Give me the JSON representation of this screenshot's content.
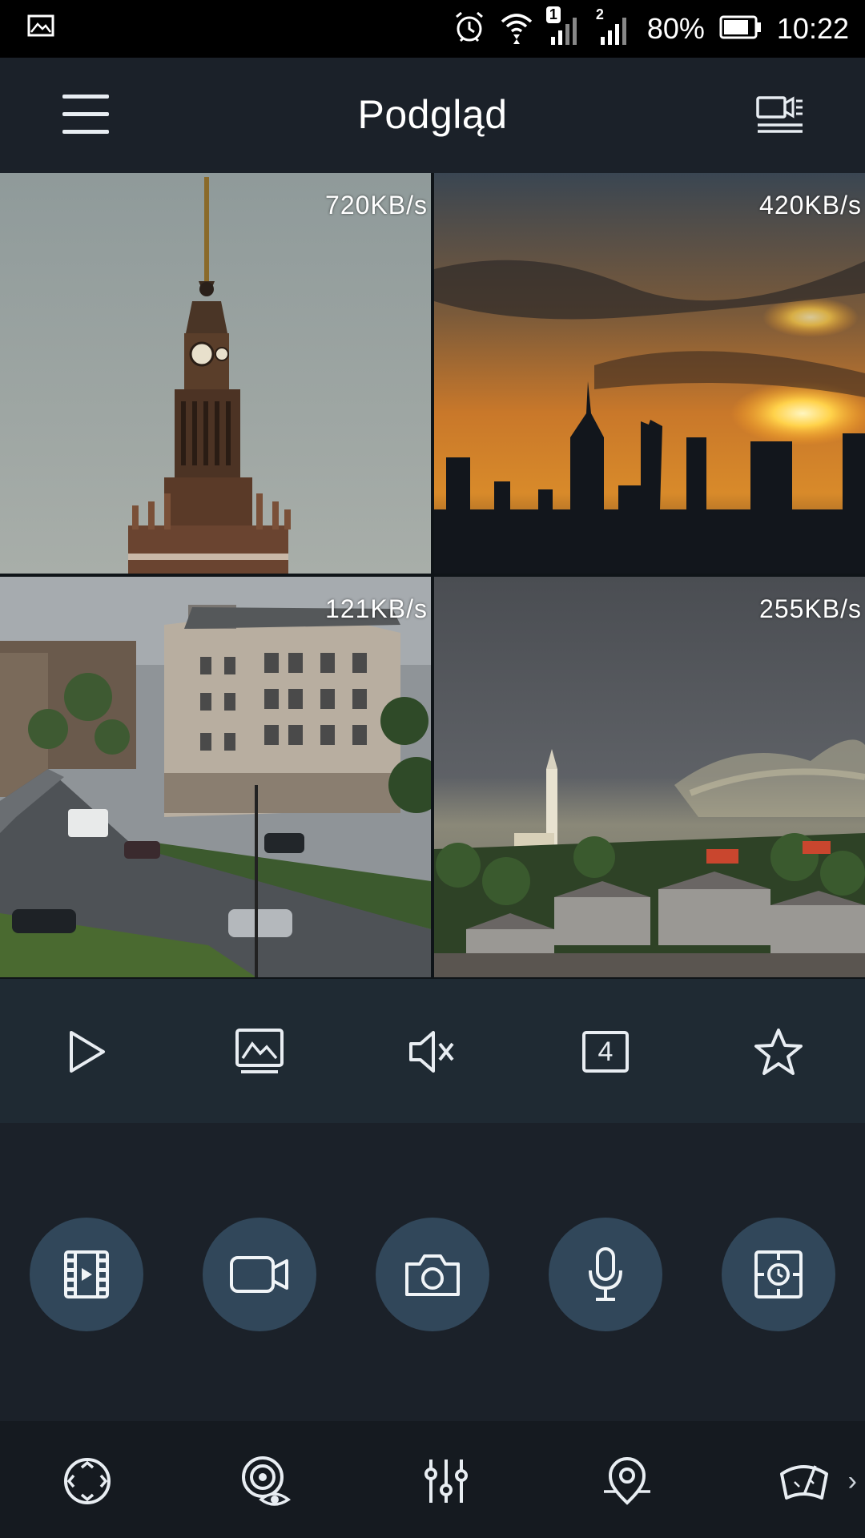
{
  "status_bar": {
    "battery_text": "80%",
    "time": "10:22",
    "sim1_label": "1",
    "sim2_label": "2",
    "icons": [
      "gallery-icon",
      "alarm-icon",
      "wifi-icon",
      "signal-sim1-icon",
      "signal-sim2-icon",
      "battery-icon"
    ]
  },
  "header": {
    "title": "Podgląd",
    "menu_icon": "hamburger-menu-icon",
    "right_icon": "camera-list-icon"
  },
  "tiles": [
    {
      "rate": "720KB/s",
      "scene": "palace-of-culture-tower",
      "selected": true
    },
    {
      "rate": "420KB/s",
      "scene": "city-skyline-sunset",
      "selected": false
    },
    {
      "rate": "121KB/s",
      "scene": "rainy-street-buildings",
      "selected": false
    },
    {
      "rate": "255KB/s",
      "scene": "stormy-sky-old-town",
      "selected": false
    }
  ],
  "controls": {
    "icons": [
      "play-icon",
      "image-quality-icon",
      "mute-icon",
      "split-4-icon",
      "favorite-star-icon"
    ],
    "split_count": "4"
  },
  "actions": {
    "icons": [
      "playback-film-icon",
      "record-video-icon",
      "snapshot-camera-icon",
      "microphone-icon",
      "cloud-playback-icon"
    ]
  },
  "bottom_bar": {
    "icons": [
      "ptz-direction-icon",
      "image-adjust-eye-icon",
      "settings-sliders-icon",
      "preset-location-icon",
      "wiper-icon"
    ],
    "more": "›"
  },
  "colors": {
    "background": "#1b2129",
    "controls_bar": "#1f2a33",
    "round_button": "#31475a",
    "selected_border": "#1aa6c6",
    "bottom_bar": "#151a20"
  }
}
